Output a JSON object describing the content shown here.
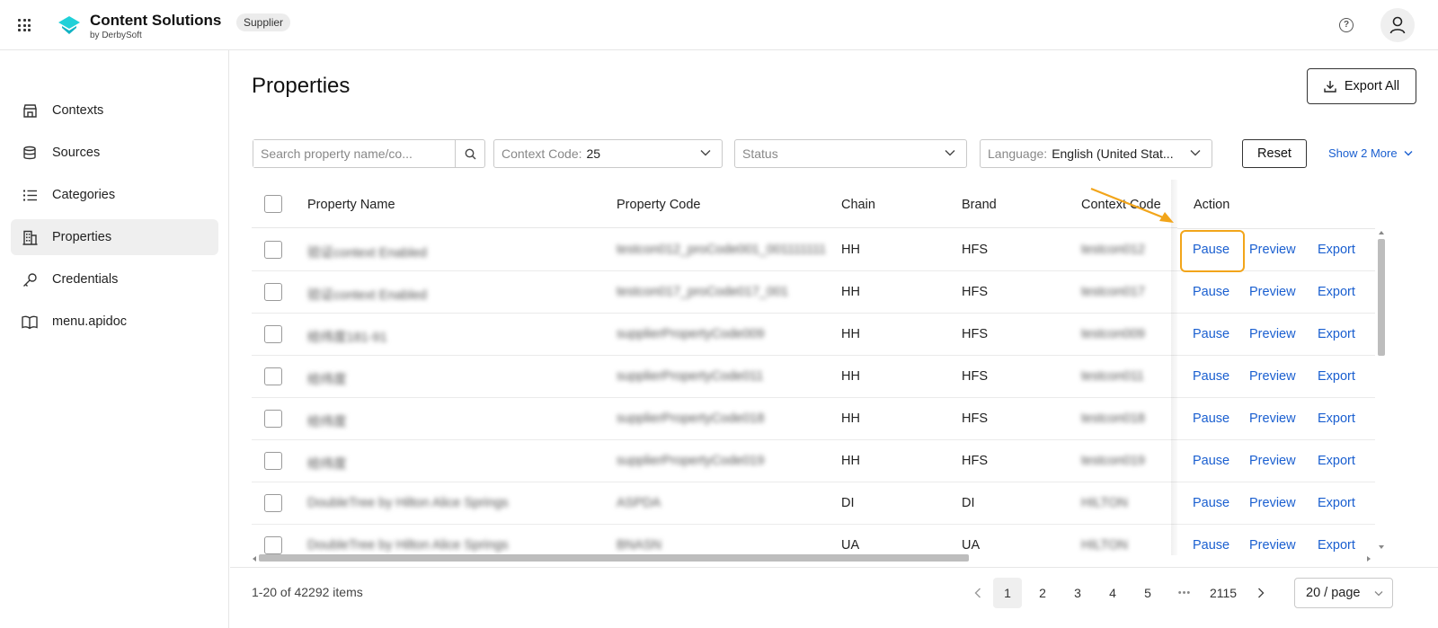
{
  "header": {
    "brand_title": "Content Solutions",
    "brand_sub": "by DerbySoft",
    "role_badge": "Supplier",
    "help_glyph": "?"
  },
  "sidebar": {
    "items": [
      {
        "label": "Contexts",
        "icon": "store-icon",
        "active": false
      },
      {
        "label": "Sources",
        "icon": "database-icon",
        "active": false
      },
      {
        "label": "Categories",
        "icon": "list-icon",
        "active": false
      },
      {
        "label": "Properties",
        "icon": "building-icon",
        "active": true
      },
      {
        "label": "Credentials",
        "icon": "key-icon",
        "active": false
      },
      {
        "label": "menu.apidoc",
        "icon": "book-icon",
        "active": false
      }
    ]
  },
  "page": {
    "title": "Properties",
    "export_all": "Export All"
  },
  "filters": {
    "search_placeholder": "Search property name/co...",
    "context_label": "Context Code:",
    "context_value": "25",
    "status_placeholder": "Status",
    "language_label": "Language:",
    "language_value": "English (United Stat...",
    "reset": "Reset",
    "show_more": "Show 2 More"
  },
  "table": {
    "columns": [
      "Property Name",
      "Property Code",
      "Chain",
      "Brand",
      "Context Code",
      "Action"
    ],
    "actions": [
      "Pause",
      "Preview",
      "Export"
    ],
    "rows": [
      {
        "name": "验证context Enabled",
        "code": "testcon012_proCode001_001111111",
        "chain": "HH",
        "brand": "HFS",
        "context": "testcon012"
      },
      {
        "name": "验证context Enabled",
        "code": "testcon017_proCode017_001",
        "chain": "HH",
        "brand": "HFS",
        "context": "testcon017"
      },
      {
        "name": "给纬度181-91",
        "code": "supplierPropertyCode009",
        "chain": "HH",
        "brand": "HFS",
        "context": "testcon009"
      },
      {
        "name": "给纬度",
        "code": "supplierPropertyCode011",
        "chain": "HH",
        "brand": "HFS",
        "context": "testcon011"
      },
      {
        "name": "给纬度",
        "code": "supplierPropertyCode018",
        "chain": "HH",
        "brand": "HFS",
        "context": "testcon018"
      },
      {
        "name": "给纬度",
        "code": "supplierPropertyCode019",
        "chain": "HH",
        "brand": "HFS",
        "context": "testcon019"
      },
      {
        "name": "DoubleTree by Hilton Alice Springs",
        "code": "ASPDA",
        "chain": "DI",
        "brand": "DI",
        "context": "HILTON"
      },
      {
        "name": "DoubleTree by Hilton Alice Springs",
        "code": "BNASN",
        "chain": "UA",
        "brand": "UA",
        "context": "HILTON"
      }
    ]
  },
  "footer": {
    "count": "1-20 of 42292 items",
    "pages": [
      "1",
      "2",
      "3",
      "4",
      "5"
    ],
    "current_page": "1",
    "ellipsis": "•••",
    "last_page": "2115",
    "page_size": "20 / page"
  },
  "colors": {
    "link": "#1a5fd0",
    "highlight": "#f2a51a",
    "logo": "#1fd0d8"
  }
}
